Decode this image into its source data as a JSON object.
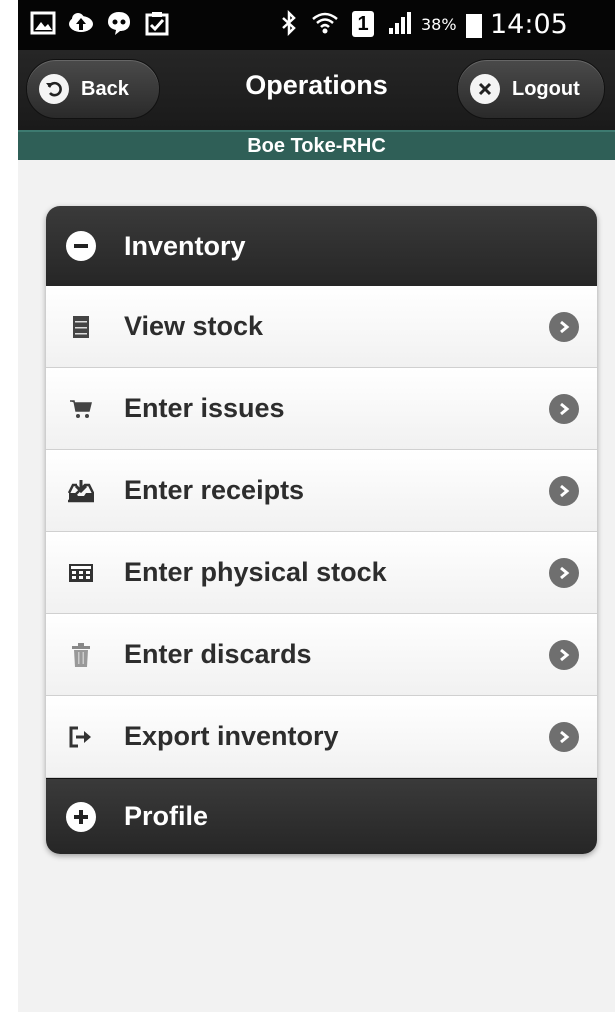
{
  "status_bar": {
    "sim_label": "1",
    "battery_percent": "38%",
    "time": "14:05"
  },
  "header": {
    "back_label": "Back",
    "title": "Operations",
    "logout_label": "Logout",
    "subtitle": "Boe Toke-RHC"
  },
  "panel": {
    "inventory_section": {
      "title": "Inventory",
      "expanded": true,
      "items": [
        {
          "label": "View stock",
          "icon": "archive-icon"
        },
        {
          "label": "Enter issues",
          "icon": "cart-icon"
        },
        {
          "label": "Enter receipts",
          "icon": "inbox-download-icon"
        },
        {
          "label": "Enter physical stock",
          "icon": "calculator-icon"
        },
        {
          "label": "Enter discards",
          "icon": "trash-icon"
        },
        {
          "label": "Export inventory",
          "icon": "export-icon"
        }
      ]
    },
    "profile_section": {
      "title": "Profile",
      "expanded": false
    }
  },
  "colors": {
    "header_bg": "#1f1f1f",
    "subheader_bg": "#2f5f57",
    "panel_head_bg": "#2e2e2e",
    "arrow_bg": "#6f6f6f"
  }
}
